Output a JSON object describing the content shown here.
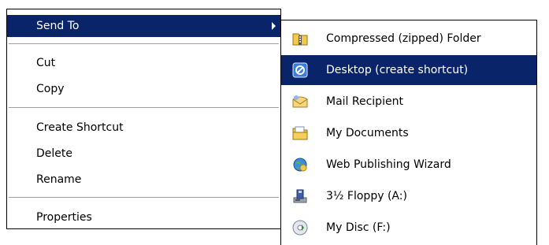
{
  "context_menu": {
    "items": [
      {
        "label": "Send To",
        "has_submenu": true,
        "selected": true
      },
      {
        "label": "Cut"
      },
      {
        "label": "Copy"
      },
      {
        "label": "Create Shortcut"
      },
      {
        "label": "Delete"
      },
      {
        "label": "Rename"
      },
      {
        "label": "Properties"
      }
    ]
  },
  "send_to_menu": {
    "items": [
      {
        "label": "Compressed (zipped) Folder",
        "icon": "zip-folder-icon"
      },
      {
        "label": "Desktop (create shortcut)",
        "icon": "desktop-icon",
        "selected": true
      },
      {
        "label": "Mail Recipient",
        "icon": "mail-icon"
      },
      {
        "label": "My Documents",
        "icon": "documents-folder-icon"
      },
      {
        "label": "Web Publishing Wizard",
        "icon": "web-publishing-icon"
      },
      {
        "label": "3½ Floppy (A:)",
        "icon": "floppy-drive-icon"
      },
      {
        "label": "My Disc (F:)",
        "icon": "disc-drive-icon"
      }
    ]
  },
  "colors": {
    "highlight": "#0a246a",
    "highlight_text": "#ffffff",
    "separator": "#a0a0a0"
  }
}
